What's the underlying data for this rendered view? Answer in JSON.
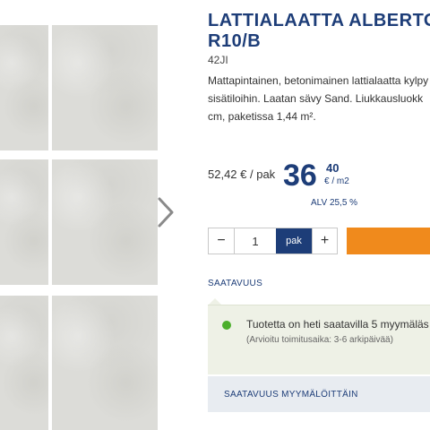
{
  "product": {
    "title": "LATTIALAATTA ALBERTO\nR10/B",
    "sku": "42JI",
    "description": "Mattapintainen, betonimainen lattialaatta kylpy\nsisätiloihin. Laatan sävy Sand. Liukkausluokk\ncm, paketissa 1,44 m²."
  },
  "price": {
    "per_package": "52,42 € / pak",
    "integer": "36",
    "cents": "40",
    "unit": "€ / m2",
    "vat": "ALV 25,5 %"
  },
  "quantity": {
    "value": "1",
    "unit": "pak",
    "minus": "−",
    "plus": "+"
  },
  "availability": {
    "label": "SAATAVUUS",
    "status": "Tuotetta on heti saatavilla 5 myymäläs",
    "delivery": "(Arvioitu toimitusaika: 3-6 arkipäivää)",
    "status_color": "#4caf2c",
    "stores_button": "SAATAVUUS MYYMÄLÖITTÄIN"
  },
  "icons": {
    "gallery_next": "chevron-right-icon"
  },
  "colors": {
    "brand": "#1d3d78",
    "cart": "#f08a1c"
  }
}
